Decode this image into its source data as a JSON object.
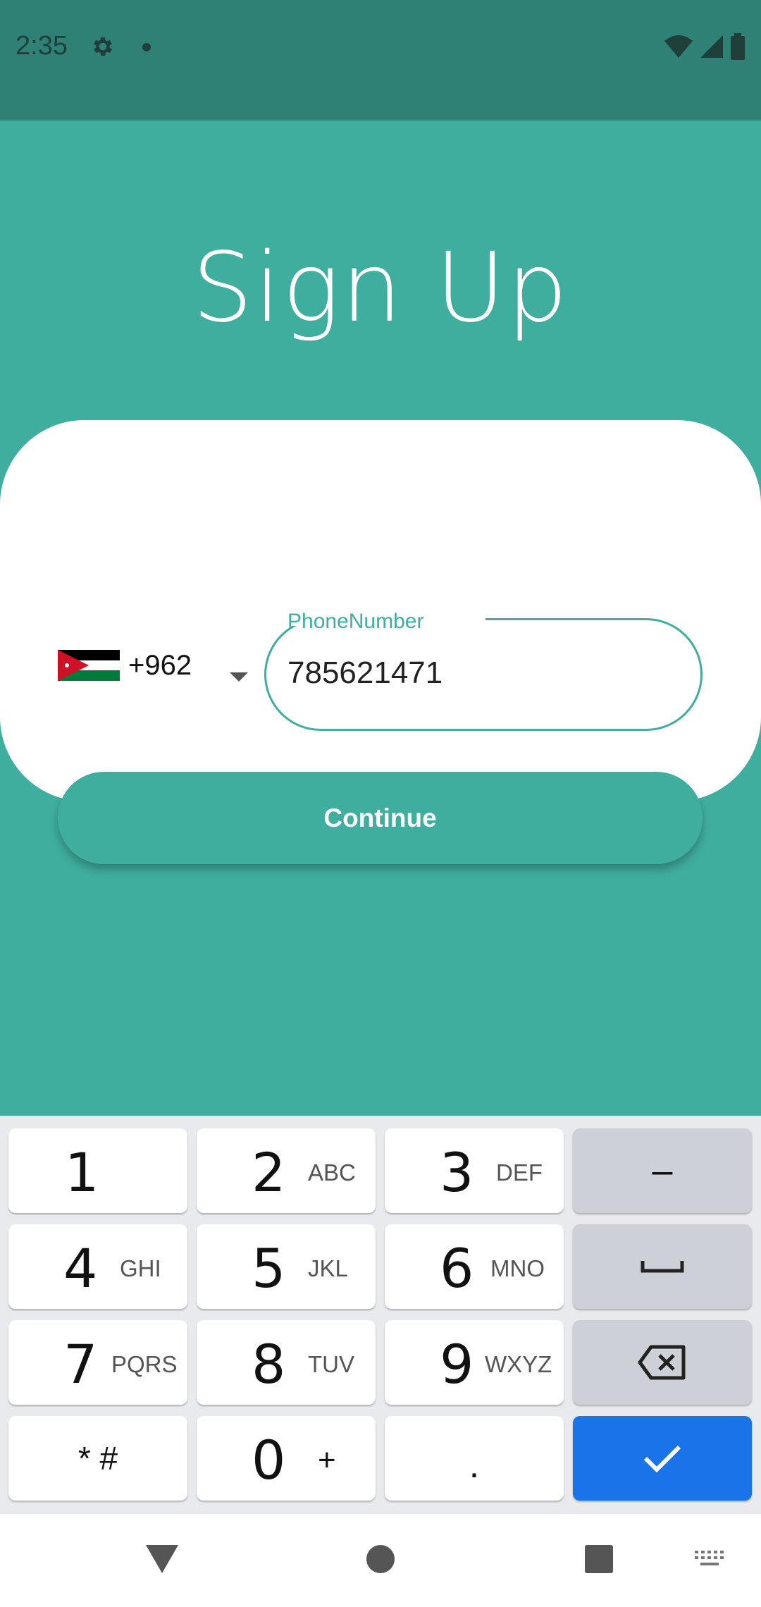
{
  "status_bar": {
    "time": "2:35",
    "icons": [
      "gear-icon",
      "notification-dot",
      "wifi-icon",
      "signal-icon",
      "battery-icon"
    ]
  },
  "screen": {
    "title": "Sign Up"
  },
  "phone_form": {
    "country_code": "+962",
    "country_flag": "jordan-flag",
    "field_label": "PhoneNumber",
    "field_value": "785621471",
    "continue_label": "Continue"
  },
  "keyboard": {
    "rows": [
      [
        {
          "main": "1",
          "sub": ""
        },
        {
          "main": "2",
          "sub": "ABC"
        },
        {
          "main": "3",
          "sub": "DEF"
        },
        {
          "main": "–",
          "sub": ""
        }
      ],
      [
        {
          "main": "4",
          "sub": "GHI"
        },
        {
          "main": "5",
          "sub": "JKL"
        },
        {
          "main": "6",
          "sub": "MNO"
        },
        {
          "main": "space",
          "sub": ""
        }
      ],
      [
        {
          "main": "7",
          "sub": "PQRS"
        },
        {
          "main": "8",
          "sub": "TUV"
        },
        {
          "main": "9",
          "sub": "WXYZ"
        },
        {
          "main": "backspace",
          "sub": ""
        }
      ],
      [
        {
          "main": "* #",
          "sub": ""
        },
        {
          "main": "0",
          "sub": "+"
        },
        {
          "main": ".",
          "sub": ""
        },
        {
          "main": "done",
          "sub": ""
        }
      ]
    ]
  },
  "nav_bar": {
    "icons": [
      "back-icon",
      "home-icon",
      "recents-icon",
      "keyboard-switch-icon"
    ]
  },
  "colors": {
    "primary": "#3fae9f",
    "status_bar": "#2f8075",
    "done_key": "#1a73e8"
  }
}
